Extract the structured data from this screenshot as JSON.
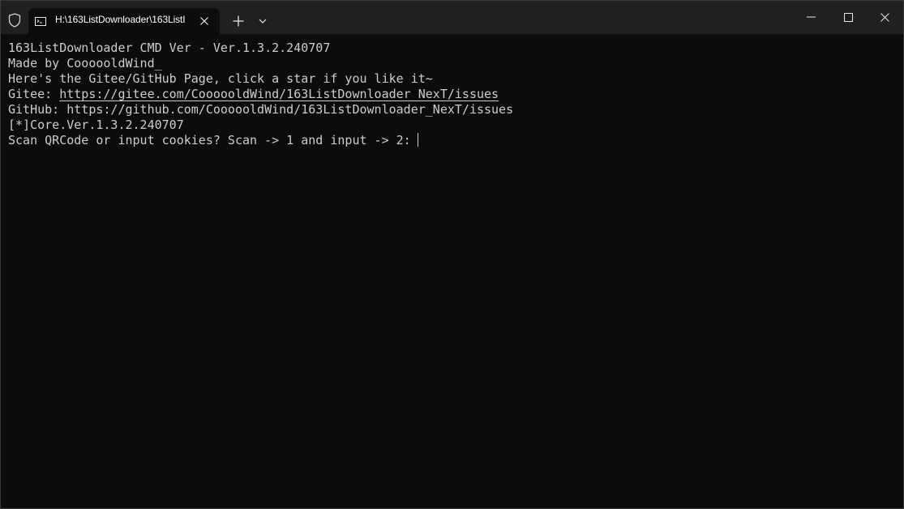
{
  "tab": {
    "title": "H:\\163ListDownloader\\163ListI",
    "icon": "cmd-icon"
  },
  "titlebar": {
    "shield_icon": "shield-icon",
    "new_tab_icon": "plus-icon",
    "dropdown_icon": "chevron-down-icon",
    "minimize_icon": "minimize-icon",
    "maximize_icon": "maximize-icon",
    "close_icon": "close-icon"
  },
  "terminal": {
    "lines": [
      {
        "text": "163ListDownloader CMD Ver - Ver.1.3.2.240707"
      },
      {
        "text": "Made by CoooooldWind_"
      },
      {
        "text": "Here's the Gitee/GitHub Page, click a star if you like it~"
      },
      {
        "prefix": "Gitee: ",
        "link": "https://gitee.com/CoooooldWind/163ListDownloader_NexT/issues"
      },
      {
        "text": "GitHub: https://github.com/CoooooldWind/163ListDownloader_NexT/issues"
      },
      {
        "text": "[*]Core.Ver.1.3.2.240707"
      },
      {
        "text": "Scan QRCode or input cookies? Scan -> 1 and input -> 2:"
      }
    ]
  },
  "colors": {
    "background": "#0c0c0c",
    "titlebar": "#202020",
    "foreground": "#cccccc"
  }
}
